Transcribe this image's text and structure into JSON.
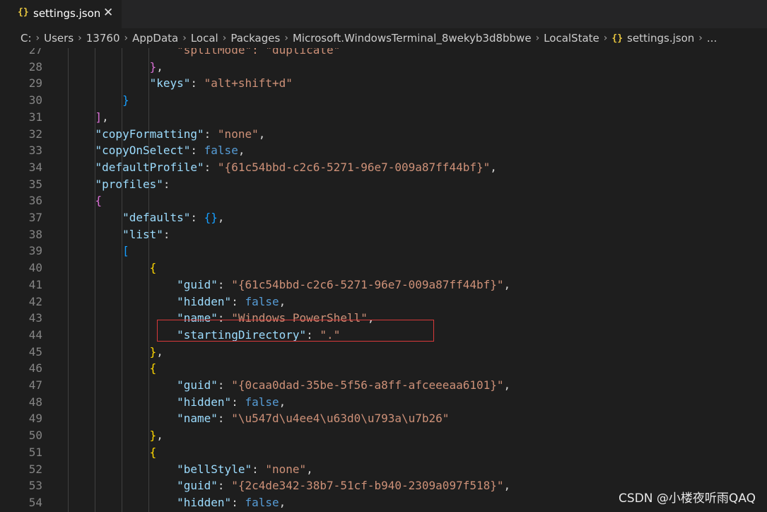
{
  "tab": {
    "icon": "{}",
    "title": "settings.json",
    "close": "✕"
  },
  "breadcrumb": {
    "items": [
      "C:",
      "Users",
      "13760",
      "AppData",
      "Local",
      "Packages",
      "Microsoft.WindowsTerminal_8wekyb3d8bbwe",
      "LocalState",
      "settings.json",
      "..."
    ],
    "file_icon": "{}",
    "separator": "›"
  },
  "editor": {
    "lines": [
      {
        "n": "27",
        "indent": 0,
        "tokens": [
          {
            "t": "                \"splitMode\": \"duplicate\"",
            "c": "s"
          }
        ]
      },
      {
        "n": "28",
        "tokens": [
          {
            "t": "            ",
            "c": "p"
          },
          {
            "t": "}",
            "c": "br2"
          },
          {
            "t": ",",
            "c": "p"
          }
        ]
      },
      {
        "n": "29",
        "tokens": [
          {
            "t": "            ",
            "c": "p"
          },
          {
            "t": "\"keys\"",
            "c": "k"
          },
          {
            "t": ": ",
            "c": "p"
          },
          {
            "t": "\"alt+shift+d\"",
            "c": "s"
          }
        ]
      },
      {
        "n": "30",
        "tokens": [
          {
            "t": "        ",
            "c": "p"
          },
          {
            "t": "}",
            "c": "br3"
          }
        ]
      },
      {
        "n": "31",
        "tokens": [
          {
            "t": "    ",
            "c": "p"
          },
          {
            "t": "]",
            "c": "br2"
          },
          {
            "t": ",",
            "c": "p"
          }
        ]
      },
      {
        "n": "32",
        "tokens": [
          {
            "t": "    ",
            "c": "p"
          },
          {
            "t": "\"copyFormatting\"",
            "c": "k"
          },
          {
            "t": ": ",
            "c": "p"
          },
          {
            "t": "\"none\"",
            "c": "s"
          },
          {
            "t": ",",
            "c": "p"
          }
        ]
      },
      {
        "n": "33",
        "tokens": [
          {
            "t": "    ",
            "c": "p"
          },
          {
            "t": "\"copyOnSelect\"",
            "c": "k"
          },
          {
            "t": ": ",
            "c": "p"
          },
          {
            "t": "false",
            "c": "b"
          },
          {
            "t": ",",
            "c": "p"
          }
        ]
      },
      {
        "n": "34",
        "tokens": [
          {
            "t": "    ",
            "c": "p"
          },
          {
            "t": "\"defaultProfile\"",
            "c": "k"
          },
          {
            "t": ": ",
            "c": "p"
          },
          {
            "t": "\"{61c54bbd-c2c6-5271-96e7-009a87ff44bf}\"",
            "c": "s"
          },
          {
            "t": ",",
            "c": "p"
          }
        ]
      },
      {
        "n": "35",
        "tokens": [
          {
            "t": "    ",
            "c": "p"
          },
          {
            "t": "\"profiles\"",
            "c": "k"
          },
          {
            "t": ":",
            "c": "p"
          }
        ]
      },
      {
        "n": "36",
        "tokens": [
          {
            "t": "    ",
            "c": "p"
          },
          {
            "t": "{",
            "c": "br2"
          }
        ]
      },
      {
        "n": "37",
        "tokens": [
          {
            "t": "        ",
            "c": "p"
          },
          {
            "t": "\"defaults\"",
            "c": "k"
          },
          {
            "t": ": ",
            "c": "p"
          },
          {
            "t": "{}",
            "c": "br3"
          },
          {
            "t": ",",
            "c": "p"
          }
        ]
      },
      {
        "n": "38",
        "tokens": [
          {
            "t": "        ",
            "c": "p"
          },
          {
            "t": "\"list\"",
            "c": "k"
          },
          {
            "t": ":",
            "c": "p"
          }
        ]
      },
      {
        "n": "39",
        "tokens": [
          {
            "t": "        ",
            "c": "p"
          },
          {
            "t": "[",
            "c": "br3"
          }
        ]
      },
      {
        "n": "40",
        "tokens": [
          {
            "t": "            ",
            "c": "p"
          },
          {
            "t": "{",
            "c": "br1"
          }
        ]
      },
      {
        "n": "41",
        "tokens": [
          {
            "t": "                ",
            "c": "p"
          },
          {
            "t": "\"guid\"",
            "c": "k"
          },
          {
            "t": ": ",
            "c": "p"
          },
          {
            "t": "\"{61c54bbd-c2c6-5271-96e7-009a87ff44bf}\"",
            "c": "s"
          },
          {
            "t": ",",
            "c": "p"
          }
        ]
      },
      {
        "n": "42",
        "tokens": [
          {
            "t": "                ",
            "c": "p"
          },
          {
            "t": "\"hidden\"",
            "c": "k"
          },
          {
            "t": ": ",
            "c": "p"
          },
          {
            "t": "false",
            "c": "b"
          },
          {
            "t": ",",
            "c": "p"
          }
        ]
      },
      {
        "n": "43",
        "tokens": [
          {
            "t": "                ",
            "c": "p"
          },
          {
            "t": "\"name\"",
            "c": "k"
          },
          {
            "t": ": ",
            "c": "p"
          },
          {
            "t": "\"Windows PowerShell\"",
            "c": "s"
          },
          {
            "t": ",",
            "c": "p"
          }
        ]
      },
      {
        "n": "44",
        "tokens": [
          {
            "t": "                ",
            "c": "p"
          },
          {
            "t": "\"startingDirectory\"",
            "c": "k"
          },
          {
            "t": ": ",
            "c": "p"
          },
          {
            "t": "\".\"",
            "c": "s"
          }
        ]
      },
      {
        "n": "45",
        "tokens": [
          {
            "t": "            ",
            "c": "p"
          },
          {
            "t": "}",
            "c": "br1"
          },
          {
            "t": ",",
            "c": "p"
          }
        ]
      },
      {
        "n": "46",
        "tokens": [
          {
            "t": "            ",
            "c": "p"
          },
          {
            "t": "{",
            "c": "br1"
          }
        ]
      },
      {
        "n": "47",
        "tokens": [
          {
            "t": "                ",
            "c": "p"
          },
          {
            "t": "\"guid\"",
            "c": "k"
          },
          {
            "t": ": ",
            "c": "p"
          },
          {
            "t": "\"{0caa0dad-35be-5f56-a8ff-afceeeaa6101}\"",
            "c": "s"
          },
          {
            "t": ",",
            "c": "p"
          }
        ]
      },
      {
        "n": "48",
        "tokens": [
          {
            "t": "                ",
            "c": "p"
          },
          {
            "t": "\"hidden\"",
            "c": "k"
          },
          {
            "t": ": ",
            "c": "p"
          },
          {
            "t": "false",
            "c": "b"
          },
          {
            "t": ",",
            "c": "p"
          }
        ]
      },
      {
        "n": "49",
        "tokens": [
          {
            "t": "                ",
            "c": "p"
          },
          {
            "t": "\"name\"",
            "c": "k"
          },
          {
            "t": ": ",
            "c": "p"
          },
          {
            "t": "\"\\u547d\\u4ee4\\u63d0\\u793a\\u7b26\"",
            "c": "s"
          }
        ]
      },
      {
        "n": "50",
        "tokens": [
          {
            "t": "            ",
            "c": "p"
          },
          {
            "t": "}",
            "c": "br1"
          },
          {
            "t": ",",
            "c": "p"
          }
        ]
      },
      {
        "n": "51",
        "tokens": [
          {
            "t": "            ",
            "c": "p"
          },
          {
            "t": "{",
            "c": "br1"
          }
        ]
      },
      {
        "n": "52",
        "tokens": [
          {
            "t": "                ",
            "c": "p"
          },
          {
            "t": "\"bellStyle\"",
            "c": "k"
          },
          {
            "t": ": ",
            "c": "p"
          },
          {
            "t": "\"none\"",
            "c": "s"
          },
          {
            "t": ",",
            "c": "p"
          }
        ]
      },
      {
        "n": "53",
        "tokens": [
          {
            "t": "                ",
            "c": "p"
          },
          {
            "t": "\"guid\"",
            "c": "k"
          },
          {
            "t": ": ",
            "c": "p"
          },
          {
            "t": "\"{2c4de342-38b7-51cf-b940-2309a097f518}\"",
            "c": "s"
          },
          {
            "t": ",",
            "c": "p"
          }
        ]
      },
      {
        "n": "54",
        "tokens": [
          {
            "t": "                ",
            "c": "p"
          },
          {
            "t": "\"hidden\"",
            "c": "k"
          },
          {
            "t": ": ",
            "c": "p"
          },
          {
            "t": "false",
            "c": "b"
          },
          {
            "t": ",",
            "c": "p"
          }
        ]
      }
    ]
  },
  "watermark": "CSDN @小楼夜听雨QAQ",
  "colors": {
    "key": "#9cdcfe",
    "string": "#ce9178",
    "boolean": "#569cd6",
    "highlight_border": "#d9393a"
  }
}
